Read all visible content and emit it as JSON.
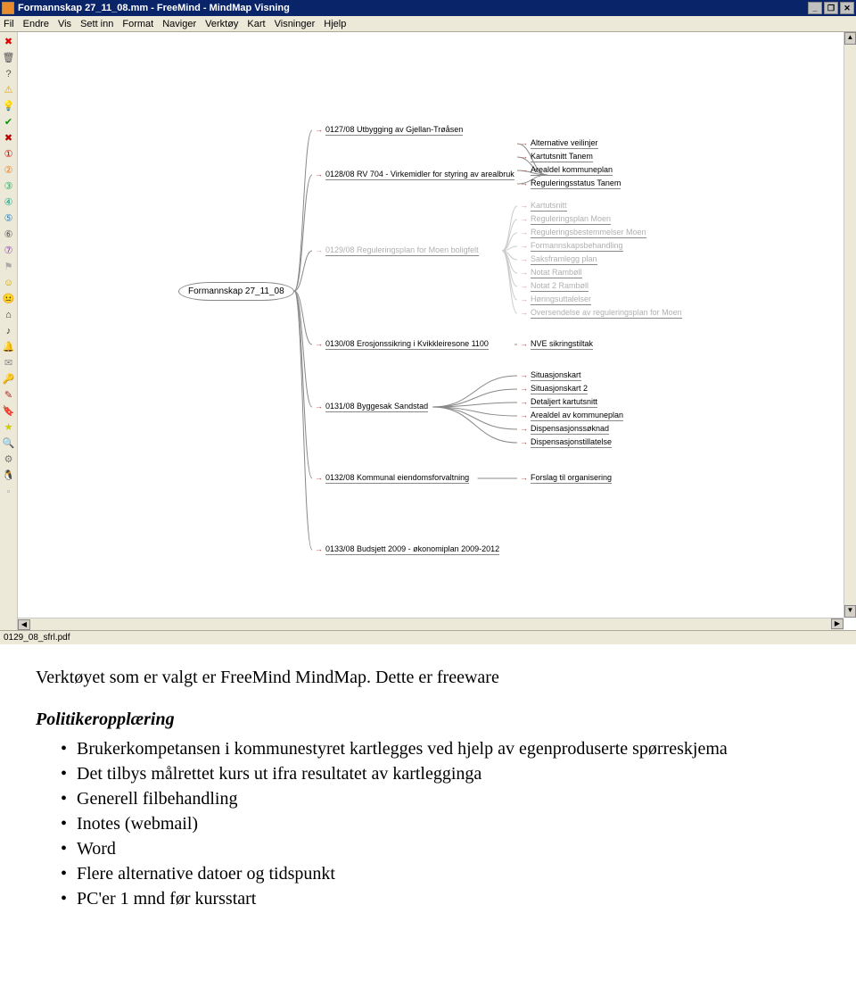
{
  "titlebar": {
    "text": "Formannskap 27_11_08.mm - FreeMind - MindMap Visning",
    "min_label": "_",
    "max_label": "❐",
    "close_label": "✕"
  },
  "menu": {
    "items": [
      "Fil",
      "Endre",
      "Vis",
      "Sett inn",
      "Format",
      "Naviger",
      "Verktøy",
      "Kart",
      "Visninger",
      "Hjelp"
    ]
  },
  "toolbar": {
    "icons": [
      {
        "name": "cancel-icon",
        "glyph": "✖",
        "color": "#d00"
      },
      {
        "name": "trash-icon",
        "glyph": "🗑",
        "color": "#555"
      },
      {
        "name": "help-icon",
        "glyph": "?",
        "color": "#555"
      },
      {
        "name": "warning-icon",
        "glyph": "⚠",
        "color": "#e9a500"
      },
      {
        "name": "idea-icon",
        "glyph": "💡",
        "color": "#e9c000"
      },
      {
        "name": "check-icon",
        "glyph": "✔",
        "color": "#090"
      },
      {
        "name": "cross-icon",
        "glyph": "✖",
        "color": "#b00"
      },
      {
        "name": "priority-1-icon",
        "glyph": "①",
        "color": "#c00"
      },
      {
        "name": "priority-2-icon",
        "glyph": "②",
        "color": "#e67e22"
      },
      {
        "name": "priority-3-icon",
        "glyph": "③",
        "color": "#27ae60"
      },
      {
        "name": "priority-4-icon",
        "glyph": "④",
        "color": "#16a085"
      },
      {
        "name": "priority-5-icon",
        "glyph": "⑤",
        "color": "#2980b9"
      },
      {
        "name": "priority-6-icon",
        "glyph": "⑥",
        "color": "#555"
      },
      {
        "name": "priority-7-icon",
        "glyph": "⑦",
        "color": "#8e44ad"
      },
      {
        "name": "flag-icon",
        "glyph": "⚑",
        "color": "#aaa"
      },
      {
        "name": "smile-icon",
        "glyph": "☺",
        "color": "#c9a200"
      },
      {
        "name": "neutral-icon",
        "glyph": "😐",
        "color": "#c9a200"
      },
      {
        "name": "home-icon",
        "glyph": "⌂",
        "color": "#333"
      },
      {
        "name": "note-icon",
        "glyph": "♪",
        "color": "#333"
      },
      {
        "name": "bell-icon",
        "glyph": "🔔",
        "color": "#555"
      },
      {
        "name": "mail-icon",
        "glyph": "✉",
        "color": "#888"
      },
      {
        "name": "key-icon",
        "glyph": "🔑",
        "color": "#a52a2a"
      },
      {
        "name": "pencil-icon",
        "glyph": "✎",
        "color": "#a52a2a"
      },
      {
        "name": "bookmark-icon",
        "glyph": "🔖",
        "color": "#a33"
      },
      {
        "name": "star-icon",
        "glyph": "★",
        "color": "#cc0"
      },
      {
        "name": "zoom-icon",
        "glyph": "🔍",
        "color": "#555"
      },
      {
        "name": "wizard-icon",
        "glyph": "⚙",
        "color": "#777"
      },
      {
        "name": "penguin-icon",
        "glyph": "🐧",
        "color": "#333"
      },
      {
        "name": "blank-icon",
        "glyph": "▫",
        "color": "#aaa"
      }
    ]
  },
  "mindmap": {
    "root": "Formannskap 27_11_08",
    "l1": [
      {
        "label": "0127/08 Utbygging av Gjellan-Trøåsen",
        "pale": false
      },
      {
        "label": "0128/08 RV 704 - Virkemidler for styring av arealbruk",
        "pale": false,
        "children": [
          {
            "label": "Alternative veilinjer"
          },
          {
            "label": "Kartutsnitt Tanem"
          },
          {
            "label": "Arealdel kommuneplan"
          },
          {
            "label": "Reguleringsstatus Tanem"
          }
        ]
      },
      {
        "label": "0129/08 Reguleringsplan for Moen boligfelt",
        "pale": true,
        "children": [
          {
            "label": "Kartutsnitt"
          },
          {
            "label": "Reguleringsplan Moen"
          },
          {
            "label": "Reguleringsbestemmelser Moen"
          },
          {
            "label": "Formannskapsbehandling"
          },
          {
            "label": "Saksframlegg plan"
          },
          {
            "label": "Notat Rambøll"
          },
          {
            "label": "Notat 2 Rambøll"
          },
          {
            "label": "Høringsuttalelser"
          },
          {
            "label": "Oversendelse av reguleringsplan for Moen"
          }
        ]
      },
      {
        "label": "0130/08 Erosjonssikring i Kvikkleiresone 1100",
        "pale": false,
        "children": [
          {
            "label": "NVE sikringstiltak"
          }
        ]
      },
      {
        "label": "0131/08 Byggesak Sandstad",
        "pale": false,
        "children": [
          {
            "label": "Situasjonskart"
          },
          {
            "label": "Situasjonskart 2"
          },
          {
            "label": "Detaljert kartutsnitt"
          },
          {
            "label": "Arealdel av kommuneplan"
          },
          {
            "label": "Dispensasjonssøknad"
          },
          {
            "label": "Dispensasjonstillatelse"
          }
        ]
      },
      {
        "label": "0132/08 Kommunal eiendomsforvaltning",
        "pale": false,
        "children": [
          {
            "label": "Forslag til organisering"
          }
        ]
      },
      {
        "label": "0133/08 Budsjett 2009 - økonomiplan 2009-2012",
        "pale": false
      }
    ]
  },
  "statusbar": {
    "text": "0129_08_sfrl.pdf"
  },
  "document": {
    "line1": "Verktøyet som er valgt er FreeMind MindMap. Dette er freeware",
    "heading": "Politikeropplæring",
    "bullets": [
      "Brukerkompetansen i kommunestyret kartlegges ved hjelp av egenproduserte spørreskjema",
      "Det tilbys målrettet kurs ut ifra resultatet av kartlegginga",
      "Generell filbehandling",
      "Inotes (webmail)",
      "Word",
      "Flere alternative datoer og tidspunkt",
      "PC'er 1 mnd før kursstart"
    ]
  }
}
